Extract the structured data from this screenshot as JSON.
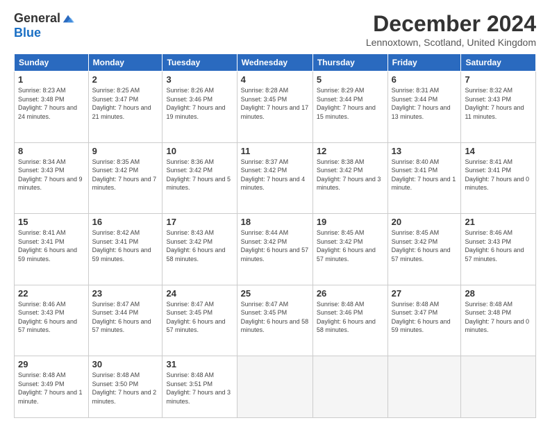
{
  "logo": {
    "general": "General",
    "blue": "Blue"
  },
  "title": "December 2024",
  "location": "Lennoxtown, Scotland, United Kingdom",
  "headers": [
    "Sunday",
    "Monday",
    "Tuesday",
    "Wednesday",
    "Thursday",
    "Friday",
    "Saturday"
  ],
  "weeks": [
    [
      {
        "day": "1",
        "sunrise": "Sunrise: 8:23 AM",
        "sunset": "Sunset: 3:48 PM",
        "daylight": "Daylight: 7 hours and 24 minutes."
      },
      {
        "day": "2",
        "sunrise": "Sunrise: 8:25 AM",
        "sunset": "Sunset: 3:47 PM",
        "daylight": "Daylight: 7 hours and 21 minutes."
      },
      {
        "day": "3",
        "sunrise": "Sunrise: 8:26 AM",
        "sunset": "Sunset: 3:46 PM",
        "daylight": "Daylight: 7 hours and 19 minutes."
      },
      {
        "day": "4",
        "sunrise": "Sunrise: 8:28 AM",
        "sunset": "Sunset: 3:45 PM",
        "daylight": "Daylight: 7 hours and 17 minutes."
      },
      {
        "day": "5",
        "sunrise": "Sunrise: 8:29 AM",
        "sunset": "Sunset: 3:44 PM",
        "daylight": "Daylight: 7 hours and 15 minutes."
      },
      {
        "day": "6",
        "sunrise": "Sunrise: 8:31 AM",
        "sunset": "Sunset: 3:44 PM",
        "daylight": "Daylight: 7 hours and 13 minutes."
      },
      {
        "day": "7",
        "sunrise": "Sunrise: 8:32 AM",
        "sunset": "Sunset: 3:43 PM",
        "daylight": "Daylight: 7 hours and 11 minutes."
      }
    ],
    [
      {
        "day": "8",
        "sunrise": "Sunrise: 8:34 AM",
        "sunset": "Sunset: 3:43 PM",
        "daylight": "Daylight: 7 hours and 9 minutes."
      },
      {
        "day": "9",
        "sunrise": "Sunrise: 8:35 AM",
        "sunset": "Sunset: 3:42 PM",
        "daylight": "Daylight: 7 hours and 7 minutes."
      },
      {
        "day": "10",
        "sunrise": "Sunrise: 8:36 AM",
        "sunset": "Sunset: 3:42 PM",
        "daylight": "Daylight: 7 hours and 5 minutes."
      },
      {
        "day": "11",
        "sunrise": "Sunrise: 8:37 AM",
        "sunset": "Sunset: 3:42 PM",
        "daylight": "Daylight: 7 hours and 4 minutes."
      },
      {
        "day": "12",
        "sunrise": "Sunrise: 8:38 AM",
        "sunset": "Sunset: 3:42 PM",
        "daylight": "Daylight: 7 hours and 3 minutes."
      },
      {
        "day": "13",
        "sunrise": "Sunrise: 8:40 AM",
        "sunset": "Sunset: 3:41 PM",
        "daylight": "Daylight: 7 hours and 1 minute."
      },
      {
        "day": "14",
        "sunrise": "Sunrise: 8:41 AM",
        "sunset": "Sunset: 3:41 PM",
        "daylight": "Daylight: 7 hours and 0 minutes."
      }
    ],
    [
      {
        "day": "15",
        "sunrise": "Sunrise: 8:41 AM",
        "sunset": "Sunset: 3:41 PM",
        "daylight": "Daylight: 6 hours and 59 minutes."
      },
      {
        "day": "16",
        "sunrise": "Sunrise: 8:42 AM",
        "sunset": "Sunset: 3:41 PM",
        "daylight": "Daylight: 6 hours and 59 minutes."
      },
      {
        "day": "17",
        "sunrise": "Sunrise: 8:43 AM",
        "sunset": "Sunset: 3:42 PM",
        "daylight": "Daylight: 6 hours and 58 minutes."
      },
      {
        "day": "18",
        "sunrise": "Sunrise: 8:44 AM",
        "sunset": "Sunset: 3:42 PM",
        "daylight": "Daylight: 6 hours and 57 minutes."
      },
      {
        "day": "19",
        "sunrise": "Sunrise: 8:45 AM",
        "sunset": "Sunset: 3:42 PM",
        "daylight": "Daylight: 6 hours and 57 minutes."
      },
      {
        "day": "20",
        "sunrise": "Sunrise: 8:45 AM",
        "sunset": "Sunset: 3:42 PM",
        "daylight": "Daylight: 6 hours and 57 minutes."
      },
      {
        "day": "21",
        "sunrise": "Sunrise: 8:46 AM",
        "sunset": "Sunset: 3:43 PM",
        "daylight": "Daylight: 6 hours and 57 minutes."
      }
    ],
    [
      {
        "day": "22",
        "sunrise": "Sunrise: 8:46 AM",
        "sunset": "Sunset: 3:43 PM",
        "daylight": "Daylight: 6 hours and 57 minutes."
      },
      {
        "day": "23",
        "sunrise": "Sunrise: 8:47 AM",
        "sunset": "Sunset: 3:44 PM",
        "daylight": "Daylight: 6 hours and 57 minutes."
      },
      {
        "day": "24",
        "sunrise": "Sunrise: 8:47 AM",
        "sunset": "Sunset: 3:45 PM",
        "daylight": "Daylight: 6 hours and 57 minutes."
      },
      {
        "day": "25",
        "sunrise": "Sunrise: 8:47 AM",
        "sunset": "Sunset: 3:45 PM",
        "daylight": "Daylight: 6 hours and 58 minutes."
      },
      {
        "day": "26",
        "sunrise": "Sunrise: 8:48 AM",
        "sunset": "Sunset: 3:46 PM",
        "daylight": "Daylight: 6 hours and 58 minutes."
      },
      {
        "day": "27",
        "sunrise": "Sunrise: 8:48 AM",
        "sunset": "Sunset: 3:47 PM",
        "daylight": "Daylight: 6 hours and 59 minutes."
      },
      {
        "day": "28",
        "sunrise": "Sunrise: 8:48 AM",
        "sunset": "Sunset: 3:48 PM",
        "daylight": "Daylight: 7 hours and 0 minutes."
      }
    ],
    [
      {
        "day": "29",
        "sunrise": "Sunrise: 8:48 AM",
        "sunset": "Sunset: 3:49 PM",
        "daylight": "Daylight: 7 hours and 1 minute."
      },
      {
        "day": "30",
        "sunrise": "Sunrise: 8:48 AM",
        "sunset": "Sunset: 3:50 PM",
        "daylight": "Daylight: 7 hours and 2 minutes."
      },
      {
        "day": "31",
        "sunrise": "Sunrise: 8:48 AM",
        "sunset": "Sunset: 3:51 PM",
        "daylight": "Daylight: 7 hours and 3 minutes."
      },
      null,
      null,
      null,
      null
    ]
  ]
}
